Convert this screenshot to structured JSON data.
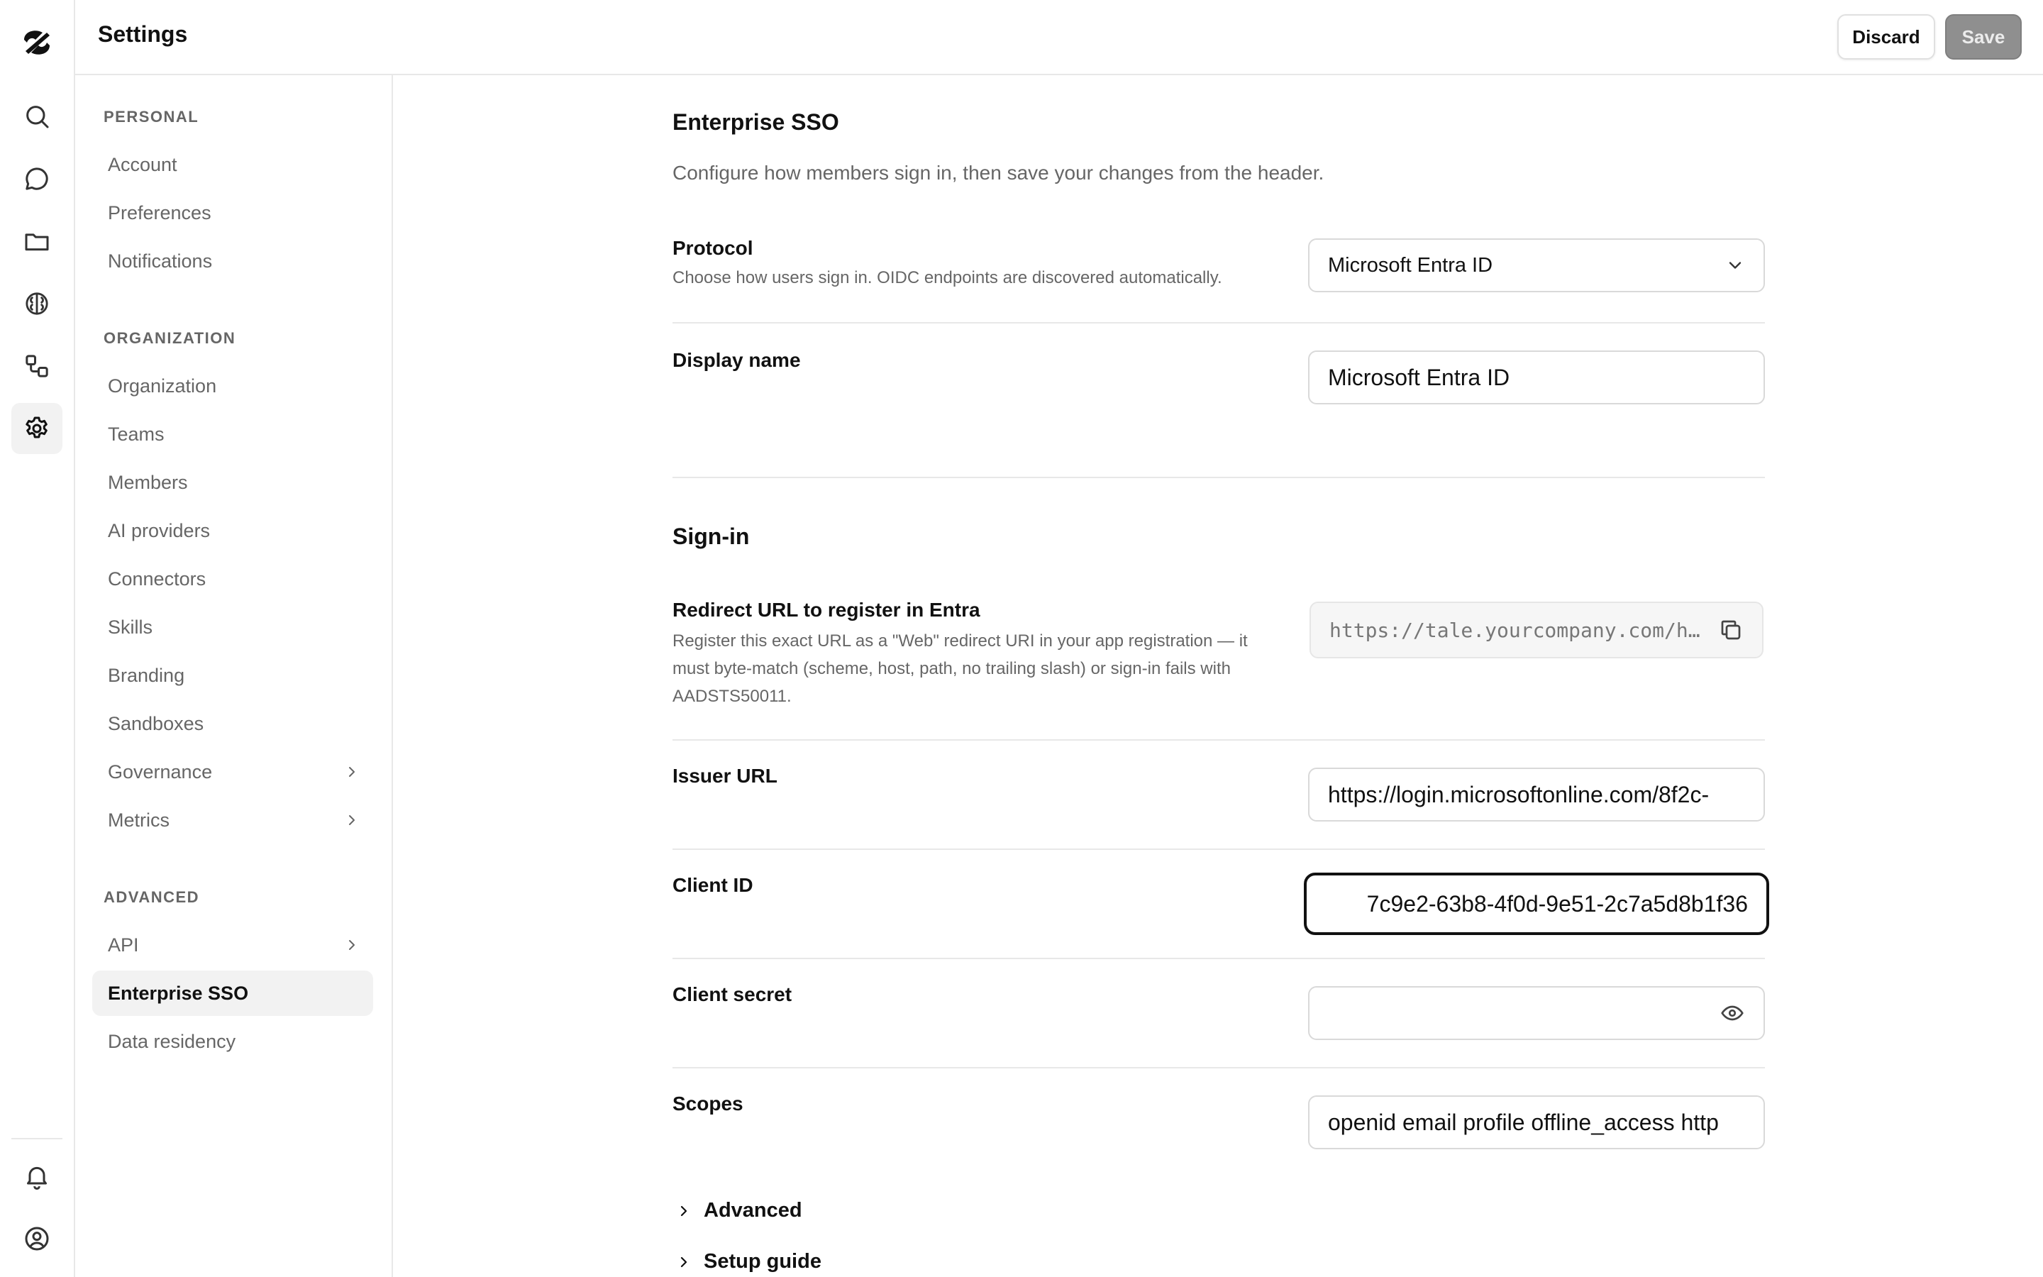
{
  "header": {
    "title": "Settings",
    "discard_label": "Discard",
    "save_label": "Save"
  },
  "rail": {
    "items": [
      {
        "icon": "search-icon"
      },
      {
        "icon": "chat-icon"
      },
      {
        "icon": "folder-icon"
      },
      {
        "icon": "brain-icon"
      },
      {
        "icon": "workflow-icon"
      },
      {
        "icon": "gear-icon",
        "active": true
      }
    ],
    "bottom": [
      {
        "icon": "bell-icon"
      },
      {
        "icon": "user-circle-icon"
      }
    ]
  },
  "nav": {
    "sections": [
      {
        "title": "PERSONAL",
        "items": [
          {
            "label": "Account"
          },
          {
            "label": "Preferences"
          },
          {
            "label": "Notifications"
          }
        ]
      },
      {
        "title": "ORGANIZATION",
        "items": [
          {
            "label": "Organization"
          },
          {
            "label": "Teams"
          },
          {
            "label": "Members"
          },
          {
            "label": "AI providers"
          },
          {
            "label": "Connectors"
          },
          {
            "label": "Skills"
          },
          {
            "label": "Branding"
          },
          {
            "label": "Sandboxes"
          },
          {
            "label": "Governance",
            "has_submenu": true
          },
          {
            "label": "Metrics",
            "has_submenu": true
          }
        ]
      },
      {
        "title": "ADVANCED",
        "items": [
          {
            "label": "API",
            "has_submenu": true
          },
          {
            "label": "Enterprise SSO",
            "active": true
          },
          {
            "label": "Data residency"
          }
        ]
      }
    ]
  },
  "main": {
    "title": "Enterprise SSO",
    "subtitle": "Configure how members sign in, then save your changes from the header.",
    "protocol": {
      "label": "Protocol",
      "description": "Choose how users sign in. OIDC endpoints are discovered automatically.",
      "value": "Microsoft Entra ID"
    },
    "display_name": {
      "label": "Display name",
      "value": "Microsoft Entra ID"
    },
    "signin": {
      "title": "Sign-in",
      "redirect": {
        "label": "Redirect URL to register in Entra",
        "description": "Register this exact URL as a \"Web\" redirect URI in your app registration — it must byte-match (scheme, host, path, no trailing slash) or sign-in fails with AADSTS50011.",
        "value": "https://tale.yourcompany.com/ht…"
      },
      "issuer": {
        "label": "Issuer URL",
        "value": "https://login.microsoftonline.com/8f2c-"
      },
      "client_id": {
        "label": "Client ID",
        "value": "7c9e2-63b8-4f0d-9e51-2c7a5d8b1f36"
      },
      "client_secret": {
        "label": "Client secret",
        "value": ""
      },
      "scopes": {
        "label": "Scopes",
        "value": "openid email profile offline_access http"
      }
    },
    "advanced_label": "Advanced",
    "setup_guide_label": "Setup guide"
  }
}
